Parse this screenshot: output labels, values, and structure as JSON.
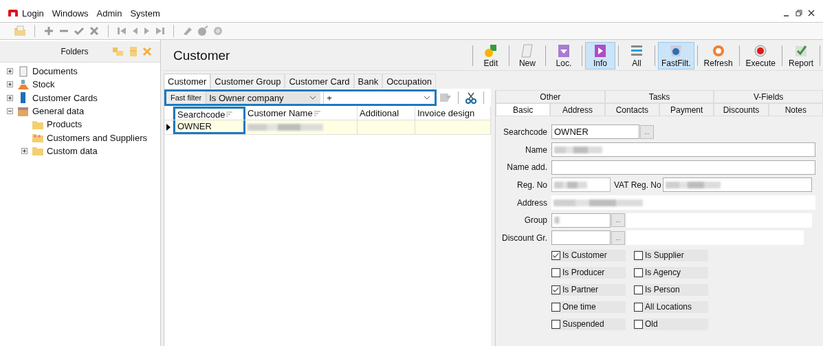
{
  "menu": {
    "items": [
      "Login",
      "Windows",
      "Admin",
      "System"
    ]
  },
  "folders": {
    "title": "Folders",
    "tree": [
      {
        "label": "Documents",
        "expanded": false
      },
      {
        "label": "Stock",
        "expanded": false
      },
      {
        "label": "Customer Cards",
        "expanded": false
      },
      {
        "label": "General data",
        "expanded": true,
        "children": [
          {
            "label": "Products"
          },
          {
            "label": "Customers and Suppliers"
          },
          {
            "label": "Custom data",
            "expanded": false
          }
        ]
      }
    ]
  },
  "page": {
    "title": "Customer"
  },
  "actions": [
    {
      "label": "Edit",
      "selected": false
    },
    {
      "label": "New",
      "selected": false
    },
    {
      "label": "Loc.",
      "selected": false
    },
    {
      "label": "Info",
      "selected": true
    },
    {
      "label": "All",
      "selected": false
    },
    {
      "label": "FastFilt.",
      "selected": true
    },
    {
      "label": "Refresh",
      "selected": false
    },
    {
      "label": "Execute",
      "selected": false
    },
    {
      "label": "Report",
      "selected": false
    }
  ],
  "tabs": [
    {
      "label": "Customer",
      "selected": true
    },
    {
      "label": "Customer Group",
      "selected": false
    },
    {
      "label": "Customer Card",
      "selected": false
    },
    {
      "label": "Bank",
      "selected": false
    },
    {
      "label": "Occupation",
      "selected": false
    }
  ],
  "filter": {
    "label": "Fast filter",
    "value": "Is Owner company",
    "condition": "+",
    "highlighted": true
  },
  "grid": {
    "columns": [
      {
        "label": "Searchcode",
        "filter": true,
        "highlighted": true
      },
      {
        "label": "Customer Name",
        "filter": true,
        "highlighted": false
      },
      {
        "label": "Additional",
        "filter": false,
        "highlighted": false
      },
      {
        "label": "Invoice design",
        "filter": false,
        "highlighted": false
      }
    ],
    "rows": [
      {
        "current": true,
        "searchcode": "OWNER",
        "name_blurred": true
      }
    ]
  },
  "detail_tabs": {
    "top": [
      {
        "label": "Other",
        "selected": false
      },
      {
        "label": "Tasks",
        "selected": false
      },
      {
        "label": "V-Fields",
        "selected": false
      }
    ],
    "bottom": [
      {
        "label": "Basic",
        "selected": true
      },
      {
        "label": "Address",
        "selected": false
      },
      {
        "label": "Contacts",
        "selected": false
      },
      {
        "label": "Payment",
        "selected": false
      },
      {
        "label": "Discounts",
        "selected": false
      },
      {
        "label": "Notes",
        "selected": false
      }
    ]
  },
  "form": {
    "searchcode": {
      "label": "Searchcode",
      "value": "OWNER",
      "browse": "..."
    },
    "name": {
      "label": "Name",
      "blurred": true
    },
    "name_add": {
      "label": "Name add."
    },
    "reg_no": {
      "label": "Reg. No",
      "blurred": true
    },
    "vat_reg_no": {
      "label": "VAT Reg. No",
      "blurred": true
    },
    "address": {
      "label": "Address",
      "blurred": true
    },
    "group": {
      "label": "Group",
      "blurred": true,
      "browse": "..."
    },
    "discount_group": {
      "label": "Discount Gr.",
      "browse": "..."
    }
  },
  "flags": [
    {
      "label": "Is Customer",
      "checked": true
    },
    {
      "label": "Is Supplier",
      "checked": false
    },
    {
      "label": "Is Producer",
      "checked": false
    },
    {
      "label": "Is Agency",
      "checked": false
    },
    {
      "label": "Is Partner",
      "checked": true
    },
    {
      "label": "Is Person",
      "checked": false
    },
    {
      "label": "One time",
      "checked": false
    },
    {
      "label": "All Locations",
      "checked": false
    },
    {
      "label": "Suspended",
      "checked": false
    },
    {
      "label": "Old",
      "checked": false
    }
  ]
}
